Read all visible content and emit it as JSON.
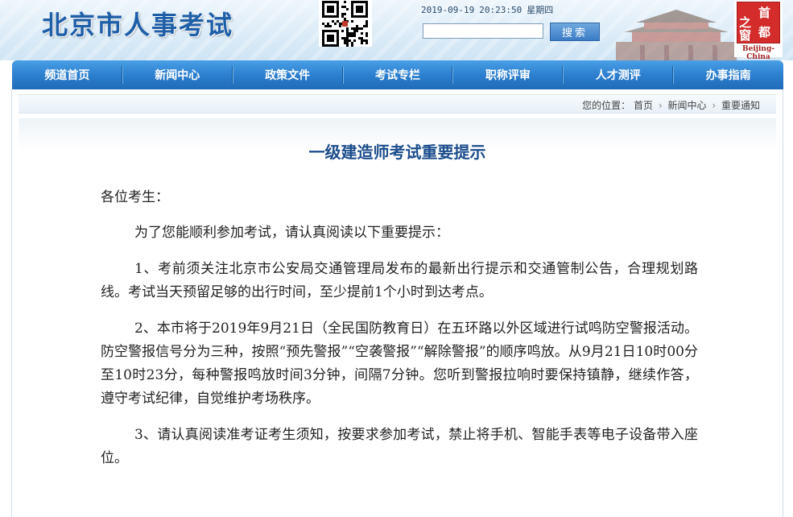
{
  "header": {
    "site_title": "北京市人事考试",
    "date": "2019-09-19",
    "time": "20:23:50",
    "weekday": "星期四",
    "search_placeholder": "",
    "search_button": "搜索",
    "logo_chars": [
      "之",
      "首",
      "窗",
      "都"
    ],
    "logo_caption": "Beijing-China"
  },
  "nav": {
    "items": [
      {
        "label": "频道首页"
      },
      {
        "label": "新闻中心"
      },
      {
        "label": "政策文件"
      },
      {
        "label": "考试专栏"
      },
      {
        "label": "职称评审"
      },
      {
        "label": "人才测评"
      },
      {
        "label": "办事指南"
      }
    ]
  },
  "breadcrumb": {
    "prefix": "您的位置：",
    "items": [
      "首页",
      "新闻中心",
      "重要通知"
    ]
  },
  "article": {
    "title": "一级建造师考试重要提示",
    "greeting": "各位考生：",
    "intro": "为了您能顺利参加考试，请认真阅读以下重要提示：",
    "paragraphs": [
      "1、考前须关注北京市公安局交通管理局发布的最新出行提示和交通管制公告，合理规划路线。考试当天预留足够的出行时间，至少提前1个小时到达考点。",
      "2、本市将于2019年9月21日（全民国防教育日）在五环路以外区域进行试鸣防空警报活动。防空警报信号分为三种，按照“预先警报”“空袭警报”“解除警报”的顺序鸣放。从9月21日10时00分至10时23分，每种警报鸣放时间3分钟，间隔7分钟。您听到警报拉响时要保持镇静，继续作答，遵守考试纪律，自觉维护考场秩序。",
      "3、请认真阅读准考证考生须知，按要求参加考试，禁止将手机、智能手表等电子设备带入座位。"
    ]
  },
  "colors": {
    "brand_blue": "#1f5fa8",
    "nav_blue": "#2c7fcf",
    "title_blue": "#1c4d8c",
    "logo_red": "#d42b2b"
  },
  "icons": {
    "qr": "qr-code-icon",
    "breadcrumb_separator": "chevron-right-icon"
  }
}
